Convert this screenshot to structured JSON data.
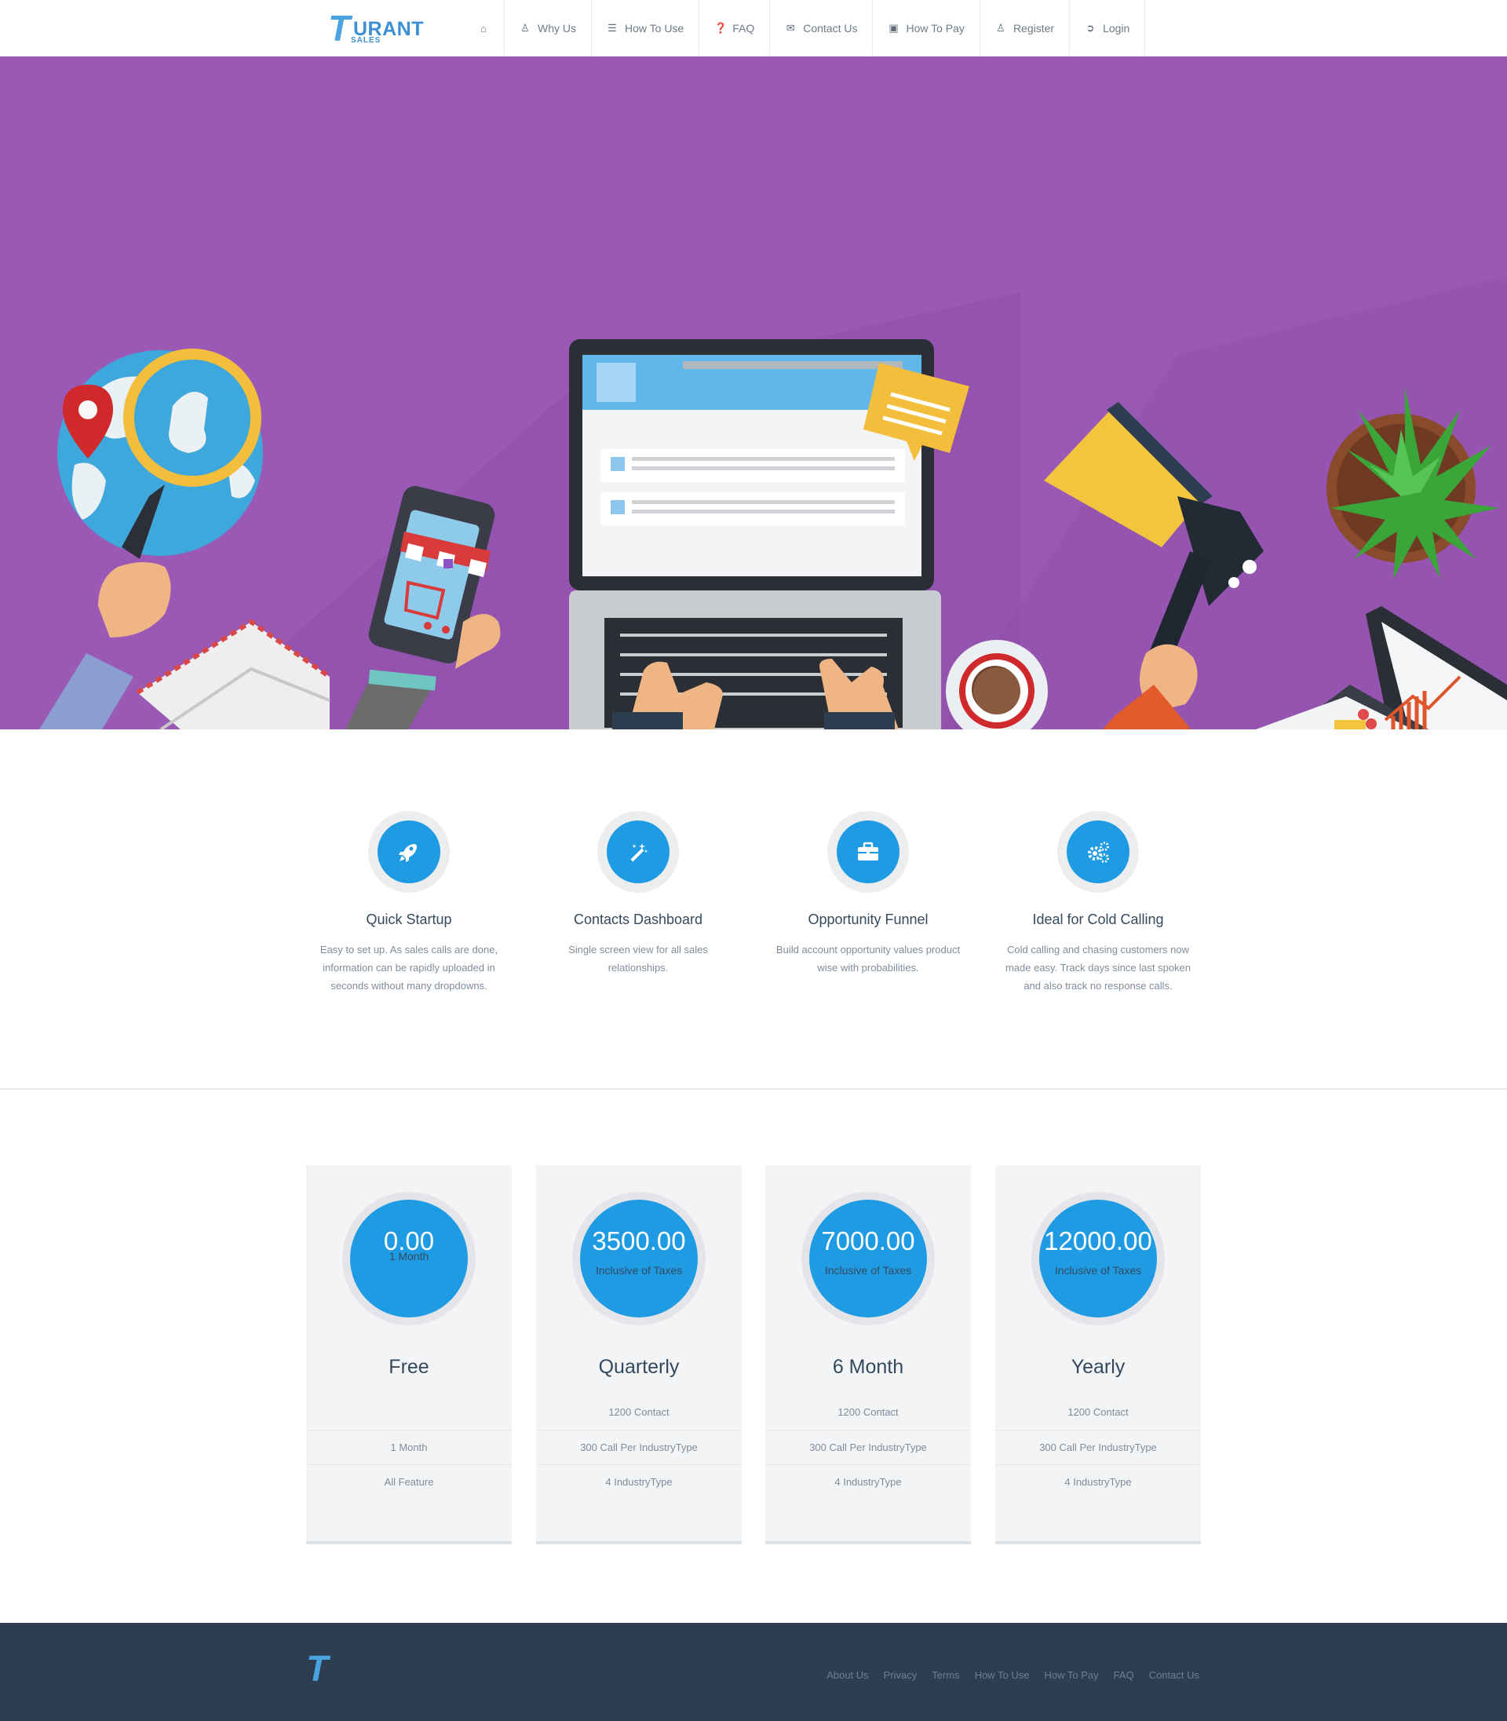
{
  "brand": {
    "logo_letter": "T",
    "logo_word": "URANT",
    "logo_sub": "SALES"
  },
  "nav": [
    {
      "label": "",
      "icon": "home-icon"
    },
    {
      "label": "Why Us",
      "icon": "user-icon"
    },
    {
      "label": "How To Use",
      "icon": "list-icon"
    },
    {
      "label": "FAQ",
      "icon": "question-circle-icon"
    },
    {
      "label": "Contact Us",
      "icon": "envelope-icon"
    },
    {
      "label": "How To Pay",
      "icon": "money-icon"
    },
    {
      "label": "Register",
      "icon": "user-icon"
    },
    {
      "label": "Login",
      "icon": "sign-in-icon"
    }
  ],
  "hero": {
    "background": "#9b59b6"
  },
  "features": [
    {
      "icon": "rocket-icon",
      "title": "Quick Startup",
      "text": "Easy to set up. As sales calls are done, information can be rapidly uploaded in seconds without many dropdowns."
    },
    {
      "icon": "magic-wand-icon",
      "title": "Contacts Dashboard",
      "text": "Single screen view for all sales relationships."
    },
    {
      "icon": "briefcase-icon",
      "title": "Opportunity Funnel",
      "text": "Build account opportunity values product wise with probabilities."
    },
    {
      "icon": "cogs-icon",
      "title": "Ideal for Cold Calling",
      "text": "Cold calling and chasing customers now made easy. Track days since last spoken and also track no response calls."
    }
  ],
  "pricing": [
    {
      "amount": "0.00",
      "sub": "1 Month",
      "name": "Free",
      "features": [
        "",
        "1 Month",
        "All Feature"
      ]
    },
    {
      "amount": "3500.00",
      "sub": "Inclusive of Taxes",
      "name": "Quarterly",
      "features": [
        "1200 Contact",
        "300 Call Per IndustryType",
        "4 IndustryType"
      ]
    },
    {
      "amount": "7000.00",
      "sub": "Inclusive of Taxes",
      "name": "6 Month",
      "features": [
        "1200 Contact",
        "300 Call Per IndustryType",
        "4 IndustryType"
      ]
    },
    {
      "amount": "12000.00",
      "sub": "Inclusive of Taxes",
      "name": "Yearly",
      "features": [
        "1200 Contact",
        "300 Call Per IndustryType",
        "4 IndustryType"
      ]
    }
  ],
  "footer": {
    "logo_letter": "T",
    "links": [
      "About Us",
      "Privacy",
      "Terms",
      "How To Use",
      "How To Pay",
      "FAQ",
      "Contact Us"
    ]
  },
  "colors": {
    "accent": "#1f9be4",
    "footer_bg": "#2c3e50",
    "hero_bg": "#9b59b6"
  }
}
